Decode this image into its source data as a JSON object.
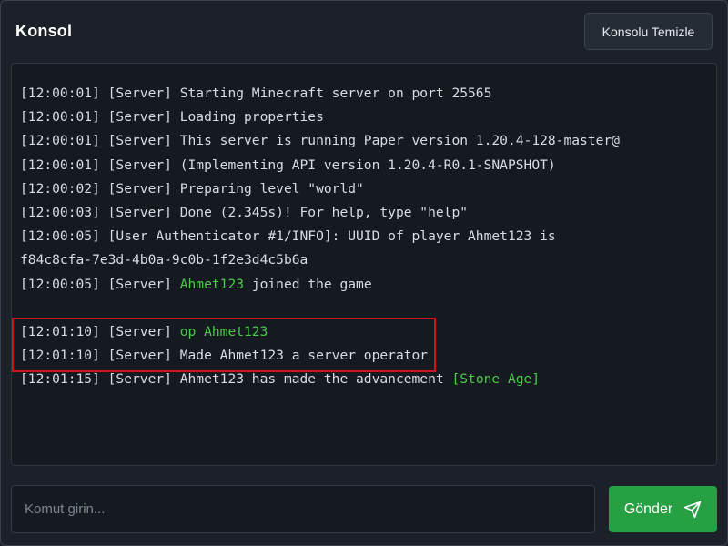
{
  "header": {
    "title": "Konsol",
    "clear_label": "Konsolu Temizle"
  },
  "console": {
    "lines": [
      [
        {
          "text": "[12:00:01] [Server] Starting Minecraft server on port 25565"
        }
      ],
      [
        {
          "text": "[12:00:01] [Server] Loading properties"
        }
      ],
      [
        {
          "text": "[12:00:01] [Server] This server is running Paper version 1.20.4-128-master@"
        }
      ],
      [
        {
          "text": "[12:00:01] [Server] (Implementing API version 1.20.4-R0.1-SNAPSHOT)"
        }
      ],
      [
        {
          "text": "[12:00:02] [Server] Preparing level \"world\""
        }
      ],
      [
        {
          "text": "[12:00:03] [Server] Done (2.345s)! For help, type \"help\""
        }
      ],
      [
        {
          "text": "[12:00:05] [User Authenticator #1/INFO]: UUID of player Ahmet123 is"
        }
      ],
      [
        {
          "text": "f84c8cfa-7e3d-4b0a-9c0b-1f2e3d4c5b6a"
        }
      ],
      [
        {
          "text": "[12:00:05] [Server] "
        },
        {
          "text": "Ahmet123",
          "color": "green"
        },
        {
          "text": " joined the game"
        }
      ],
      [],
      [
        {
          "text": "[12:01:10] [Server] "
        },
        {
          "text": "op Ahmet123",
          "color": "green"
        }
      ],
      [
        {
          "text": "[12:01:10] [Server] Made Ahmet123 a server operator"
        }
      ],
      [
        {
          "text": "[12:01:15] [Server] Ahmet123 has made the advancement "
        },
        {
          "text": "[Stone Age]",
          "color": "green"
        }
      ]
    ]
  },
  "command": {
    "placeholder": "Komut girin...",
    "value": "",
    "send_label": "Gönder",
    "send_icon": "paper-plane-icon"
  },
  "colors": {
    "background": "#1c2129",
    "console_bg": "#151a21",
    "accent_green": "#27a043",
    "log_green": "#4cc94a",
    "highlight_red": "#d0141b"
  }
}
